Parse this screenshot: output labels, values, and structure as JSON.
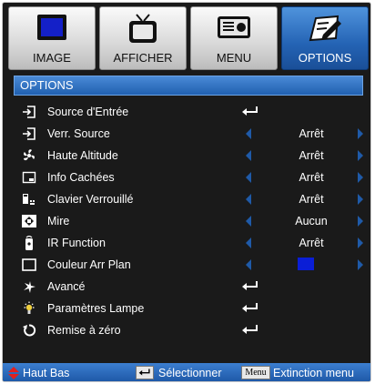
{
  "tabs": [
    {
      "label": "IMAGE",
      "icon": "monitor-icon",
      "active": false
    },
    {
      "label": "AFFICHER",
      "icon": "tv-icon",
      "active": false
    },
    {
      "label": "MENU",
      "icon": "menu-panel-icon",
      "active": false
    },
    {
      "label": "OPTIONS",
      "icon": "options-pen-icon",
      "active": true
    }
  ],
  "title": "OPTIONS",
  "items": [
    {
      "label": "Source d'Entrée",
      "icon": "input-source-icon",
      "type": "enter"
    },
    {
      "label": "Verr. Source",
      "icon": "source-lock-icon",
      "type": "value",
      "value": "Arrêt"
    },
    {
      "label": "Haute Altitude",
      "icon": "fan-icon",
      "type": "value",
      "value": "Arrêt"
    },
    {
      "label": "Info Cachées",
      "icon": "info-hide-icon",
      "type": "value",
      "value": "Arrêt"
    },
    {
      "label": "Clavier Verrouillé",
      "icon": "keypad-lock-icon",
      "type": "value",
      "value": "Arrêt"
    },
    {
      "label": "Mire",
      "icon": "test-pattern-icon",
      "type": "value",
      "value": "Aucun"
    },
    {
      "label": "IR Function",
      "icon": "remote-icon",
      "type": "value",
      "value": "Arrêt"
    },
    {
      "label": "Couleur Arr Plan",
      "icon": "background-color-icon",
      "type": "color",
      "value": "#0a1ed6"
    },
    {
      "label": "Avancé",
      "icon": "advanced-star-icon",
      "type": "enter"
    },
    {
      "label": "Paramètres Lampe",
      "icon": "lamp-icon",
      "type": "enter"
    },
    {
      "label": "Remise à zéro",
      "icon": "reset-icon",
      "type": "enter"
    }
  ],
  "bottom": {
    "nav_label": "Haut Bas",
    "select_label": "Sélectionner",
    "menu_key": "Menu",
    "exit_label": "Extinction menu"
  },
  "colors": {
    "accent": "#2463b4",
    "arrow": "#1f5aa8",
    "background": "#1a1a1a"
  }
}
